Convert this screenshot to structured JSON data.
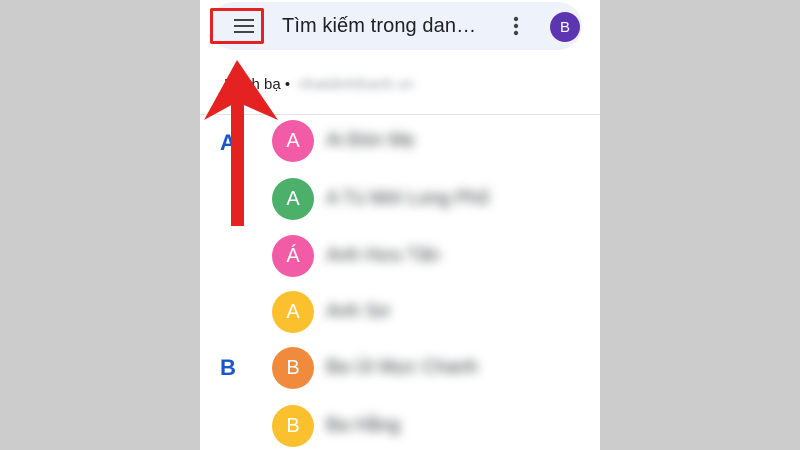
{
  "search": {
    "text": "Tìm kiếm trong dan…"
  },
  "account": {
    "avatar_letter": "B",
    "label": "Danh bạ •",
    "email": "nhatdinhthanh.vn"
  },
  "colors": {
    "pink": "#f25ba6",
    "green": "#4caf6a",
    "yellow": "#fbc02d",
    "orange": "#f08a3c",
    "highlight_red": "#e52222",
    "section_blue": "#1a56c8"
  },
  "sections": [
    {
      "letter": "A",
      "contacts": [
        {
          "initial": "A",
          "name": "Ai Đón Mẹ",
          "color": "#f25ba6"
        },
        {
          "initial": "A",
          "name": "A Tú Mới Long Phố",
          "color": "#4caf6a"
        },
        {
          "initial": "Á",
          "name": "Anh Hưu Tấn",
          "color": "#f25ba6"
        },
        {
          "initial": "A",
          "name": "Anh Sơ",
          "color": "#fbc02d"
        }
      ]
    },
    {
      "letter": "B",
      "contacts": [
        {
          "initial": "B",
          "name": "Ba Út Mực Chanh",
          "color": "#f08a3c"
        },
        {
          "initial": "B",
          "name": "Ba Hằng",
          "color": "#fbc02d"
        }
      ]
    }
  ]
}
